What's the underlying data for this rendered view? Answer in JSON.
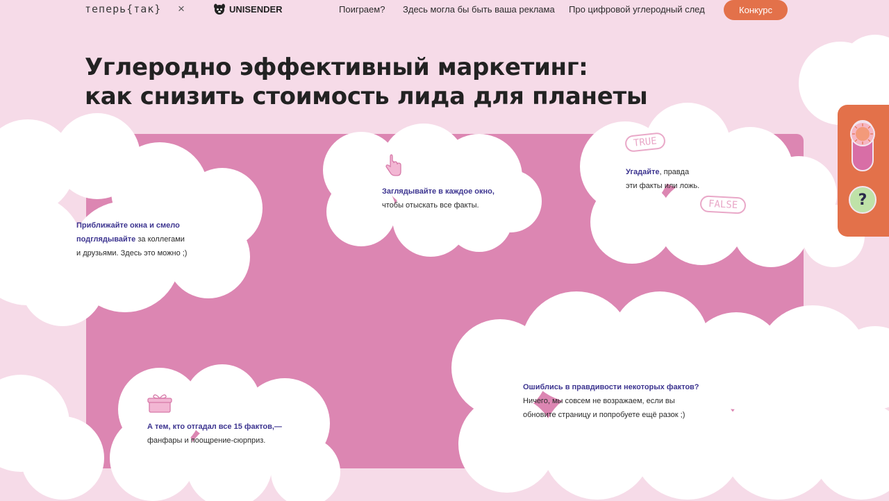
{
  "header": {
    "logo_text": "теперь{так}",
    "logo_separator": "×",
    "partner_logo": "UNISENDER",
    "nav": [
      "Поиграем?",
      "Здесь могла бы быть ваша реклама",
      "Про цифровой углеродный след"
    ],
    "cta_label": "Конкурс"
  },
  "page": {
    "title_line1": "Углеродно эффективный маркетинг:",
    "title_line2": "как снизить стоимость лида для планеты"
  },
  "hints": {
    "left": {
      "bold1": "Приближайте окна и смело",
      "bold2": "подглядывайте",
      "rest2": " за коллегами",
      "line3": "и друзьями. Здесь это можно ;)"
    },
    "center": {
      "bold": "Заглядывайте в каждое окно,",
      "line2": "чтобы отыскать все факты."
    },
    "right": {
      "bold": "Угадайте",
      "rest1": ", правда",
      "line2": "эти факты или ложь.",
      "tag_true": "TRUE",
      "tag_false": "FALSE"
    },
    "bottom_left": {
      "bold": "А тем, кто отгадал все 15 фактов,—",
      "line2": "фанфары и поощрение-сюрприз."
    },
    "bottom_right": {
      "bold": "Ошиблись в правдивости некоторых фактов?",
      "line2": "Ничего, мы совсем не возражаем, если вы",
      "line3": "обновите страницу и попробуете ещё разок ;)"
    }
  },
  "side_widget": {
    "help_label": "?",
    "lamp_icon": "sun-lamp-icon",
    "help_icon": "question-icon"
  },
  "colors": {
    "background": "#f6dbe8",
    "panel": "#dc86b2",
    "accent": "#e3714a",
    "highlight_text": "#3d3590",
    "cloud": "#ffffff"
  }
}
